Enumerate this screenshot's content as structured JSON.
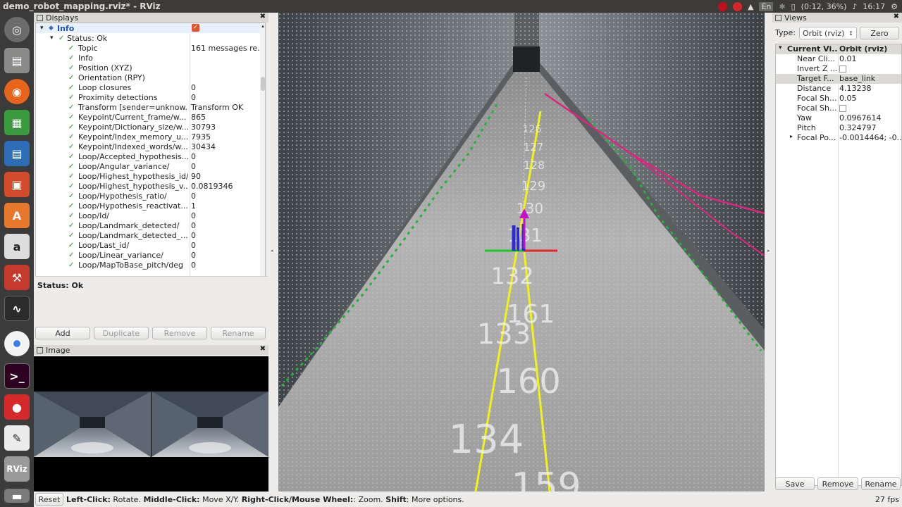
{
  "window": {
    "title": "demo_robot_mapping.rviz* - RViz"
  },
  "topbar": {
    "lang": "En",
    "battery": "(0:12, 36%)",
    "time": "16:17"
  },
  "displays": {
    "header": "Displays",
    "info_label": "Info",
    "status_label": "Status: Ok",
    "rows": [
      {
        "name": "Topic",
        "value": "161 messages re..."
      },
      {
        "name": "Info",
        "value": ""
      },
      {
        "name": "Position (XYZ)",
        "value": ""
      },
      {
        "name": "Orientation (RPY)",
        "value": ""
      },
      {
        "name": "Loop closures",
        "value": "0"
      },
      {
        "name": "Proximity detections",
        "value": "0"
      },
      {
        "name": "Transform [sender=unknow...",
        "value": "Transform OK"
      },
      {
        "name": "Keypoint/Current_frame/w...",
        "value": "865"
      },
      {
        "name": "Keypoint/Dictionary_size/w...",
        "value": "30793"
      },
      {
        "name": "Keypoint/Index_memory_u...",
        "value": "7935"
      },
      {
        "name": "Keypoint/Indexed_words/w...",
        "value": "30434"
      },
      {
        "name": "Loop/Accepted_hypothesis...",
        "value": "0"
      },
      {
        "name": "Loop/Angular_variance/",
        "value": "0"
      },
      {
        "name": "Loop/Highest_hypothesis_id/",
        "value": "90"
      },
      {
        "name": "Loop/Highest_hypothesis_v...",
        "value": "0.0819346"
      },
      {
        "name": "Loop/Hypothesis_ratio/",
        "value": "0"
      },
      {
        "name": "Loop/Hypothesis_reactivat...",
        "value": "1"
      },
      {
        "name": "Loop/Id/",
        "value": "0"
      },
      {
        "name": "Loop/Landmark_detected/",
        "value": "0"
      },
      {
        "name": "Loop/Landmark_detected_...",
        "value": "0"
      },
      {
        "name": "Loop/Last_id/",
        "value": "0"
      },
      {
        "name": "Loop/Linear_variance/",
        "value": "0"
      },
      {
        "name": "Loop/MapToBase_pitch/deg",
        "value": "0"
      }
    ],
    "status_text": "Status: Ok",
    "buttons": {
      "add": "Add",
      "duplicate": "Duplicate",
      "remove": "Remove",
      "rename": "Rename"
    }
  },
  "image_panel": {
    "header": "Image"
  },
  "view3d": {
    "node_labels": [
      "126",
      "127",
      "128",
      "129",
      "130",
      "131",
      "132",
      "161",
      "133",
      "160",
      "134",
      "159"
    ]
  },
  "views": {
    "header": "Views",
    "type_label": "Type:",
    "type_value": "Orbit (rviz)",
    "zero_button": "Zero",
    "current_view_name": "Current Vi...",
    "current_view_value": "Orbit (rviz)",
    "rows": [
      {
        "name": "Near Cli...",
        "value": "0.01"
      },
      {
        "name": "Invert Z ...",
        "value": ""
      },
      {
        "name": "Target F...",
        "value": "base_link"
      },
      {
        "name": "Distance",
        "value": "4.13238"
      },
      {
        "name": "Focal Sh...",
        "value": "0.05"
      },
      {
        "name": "Focal Sh...",
        "value": ""
      },
      {
        "name": "Yaw",
        "value": "0.0967614"
      },
      {
        "name": "Pitch",
        "value": "0.324797"
      },
      {
        "name": "Focal Po...",
        "value": "-0.0014464; -0...."
      }
    ],
    "buttons": {
      "save": "Save",
      "remove": "Remove",
      "rename": "Rename"
    }
  },
  "bottombar": {
    "reset": "Reset",
    "hint_left_bold": "Left-Click:",
    "hint_left": " Rotate. ",
    "hint_mid_bold": "Middle-Click:",
    "hint_mid": " Move X/Y. ",
    "hint_right_bold": "Right-Click/Mouse Wheel:",
    "hint_right": ": Zoom. ",
    "hint_shift_bold": "Shift",
    "hint_shift": ": More options.",
    "fps": "27 fps"
  }
}
